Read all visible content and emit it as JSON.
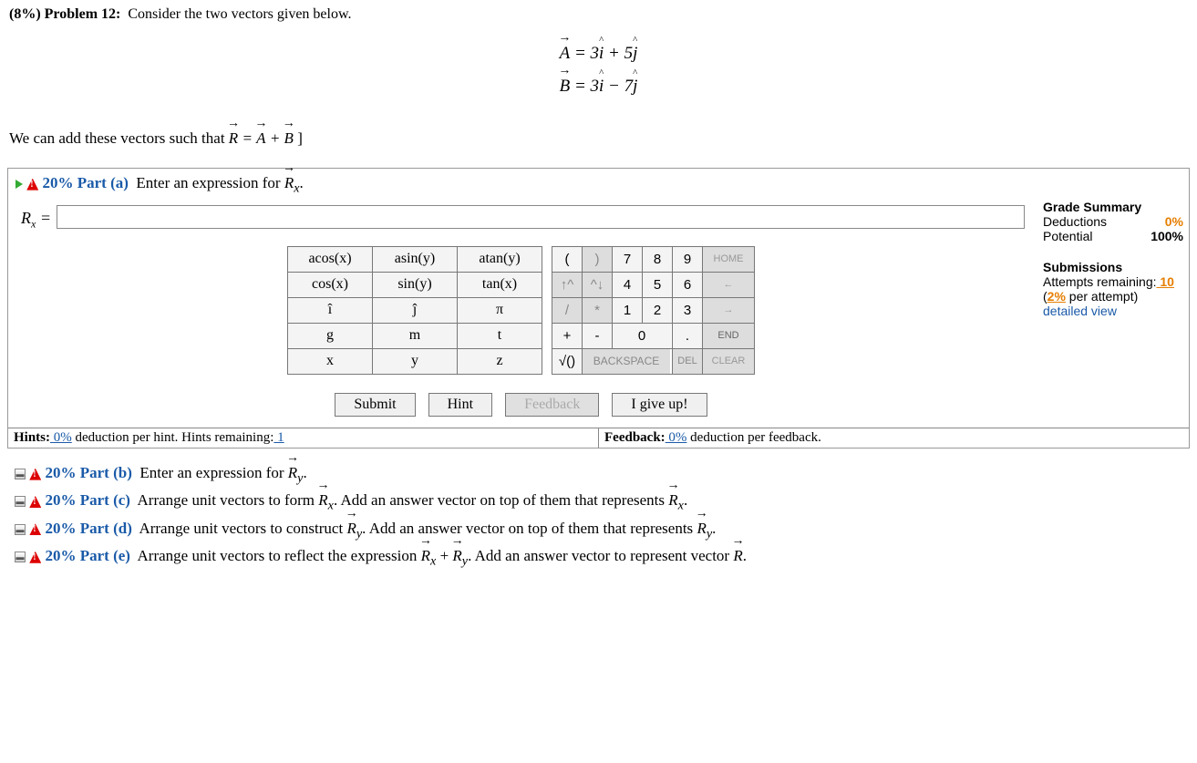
{
  "problem": {
    "weight": "(8%)",
    "number": "Problem 12:",
    "prompt": "Consider the two vectors given below.",
    "follow_text_a": "We can add these vectors such that ",
    "follow_text_b": "]"
  },
  "equations": {
    "vecA": "A",
    "eqA": " = 3",
    "i1": "i",
    "plus": " + 5",
    "j1": "j",
    "vecB": "B",
    "eqB": " = 3",
    "i2": "i",
    "minus": " − 7",
    "j2": "j",
    "vecR": "R",
    "eqR": " = ",
    "plusR": " + "
  },
  "part_a": {
    "percent": "20% Part (a)",
    "prompt": "Enter an expression for ",
    "prompt_var": "R",
    "prompt_sub": "x",
    "prompt_end": ".",
    "answer_label_var": "R",
    "answer_label_sub": "x",
    "answer_eq": " ="
  },
  "keypad": {
    "funcs": [
      [
        "acos(x)",
        "asin(y)",
        "atan(y)"
      ],
      [
        "cos(x)",
        "sin(y)",
        "tan(x)"
      ],
      [
        "î",
        "ĵ",
        "π"
      ],
      [
        "g",
        "m",
        "t"
      ],
      [
        "x",
        "y",
        "z"
      ]
    ]
  },
  "numpad": {
    "r0": {
      "a": "(",
      "b": ")",
      "c": "7",
      "d": "8",
      "e": "9",
      "f": "HOME"
    },
    "r1": {
      "a": "↑^",
      "b": "^↓",
      "c": "4",
      "d": "5",
      "e": "6",
      "f": "←"
    },
    "r2": {
      "a": "/",
      "b": "*",
      "c": "1",
      "d": "2",
      "e": "3",
      "f": "→"
    },
    "r3": {
      "a": "+",
      "b": "-",
      "c": "0",
      "d": ".",
      "e": "END"
    },
    "r4": {
      "a": "√()",
      "b": "BACKSPACE",
      "c": "DEL",
      "d": "CLEAR"
    }
  },
  "actions": {
    "submit": "Submit",
    "hint": "Hint",
    "feedback": "Feedback",
    "giveup": "I give up!"
  },
  "bottom": {
    "hints_label": "Hints:",
    "hints_pct": " 0%",
    "hints_text": "  deduction per hint. Hints remaining:",
    "hints_remain": " 1",
    "fb_label": "Feedback:",
    "fb_pct": " 0%",
    "fb_text": "  deduction per feedback."
  },
  "grade": {
    "title": "Grade Summary",
    "deductions_label": "Deductions",
    "deductions_val": "0%",
    "potential_label": "Potential",
    "potential_val": "100%",
    "subs_title": "Submissions",
    "attempts_label": "Attempts remaining:",
    "attempts_val": " 10",
    "per_attempt_a": "(",
    "per_attempt_pct": "2%",
    "per_attempt_b": " per attempt)",
    "detailed": "detailed view"
  },
  "parts": {
    "b": {
      "label": "20% Part (b)",
      "text": "Enter an expression for ",
      "var": "R",
      "sub": "y",
      "end": "."
    },
    "c": {
      "label": "20% Part (c)",
      "text": "Arrange unit vectors to form ",
      "var1": "R",
      "sub1": "x",
      "mid": ". Add an answer vector on top of them that represents ",
      "var2": "R",
      "sub2": "x",
      "end": "."
    },
    "d": {
      "label": "20% Part (d)",
      "text": "Arrange unit vectors to construct ",
      "var1": "R",
      "sub1": "y",
      "mid": ". Add an answer vector on top of them that represents ",
      "var2": "R",
      "sub2": "y",
      "end": "."
    },
    "e": {
      "label": "20% Part (e)",
      "text": "Arrange unit vectors to reflect the expression ",
      "var1": "R",
      "sub1": "x",
      "plus": " + ",
      "var2": "R",
      "sub2": "y",
      "mid": ". Add an answer vector to represent vector ",
      "var3": "R",
      "end": "."
    }
  }
}
